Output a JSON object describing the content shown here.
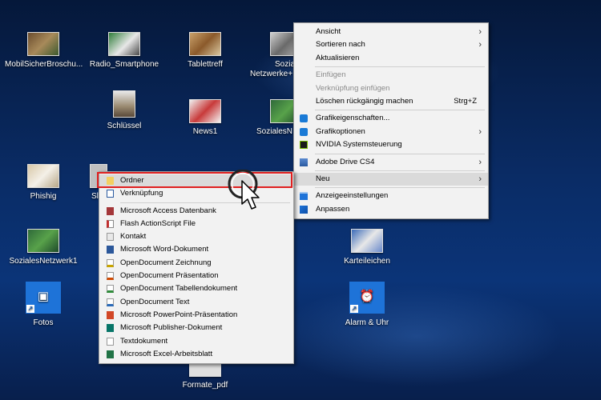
{
  "desktop": {
    "icons": [
      {
        "label": "MobilSicherBroschu..."
      },
      {
        "label": "Radio_Smartphone"
      },
      {
        "label": "Tablettreff"
      },
      {
        "label": "Sozia"
      },
      {
        "label2": "Netzwerke+"
      },
      {
        "label": "Schlüssel"
      },
      {
        "label": "News1"
      },
      {
        "label": "SozialesN"
      },
      {
        "label": "Phishig"
      },
      {
        "label": "Sl"
      },
      {
        "label": "SozialesNetzwerk1"
      },
      {
        "label": "Karteileichen"
      },
      {
        "label": "Fotos"
      },
      {
        "label": "Alarm & Uhr"
      },
      {
        "label": "Formate_pdf"
      }
    ]
  },
  "context_menu": {
    "items": [
      {
        "label": "Ansicht",
        "submenu": true
      },
      {
        "label": "Sortieren nach",
        "submenu": true
      },
      {
        "label": "Aktualisieren"
      },
      {
        "label": "Einfügen",
        "disabled": true
      },
      {
        "label": "Verknüpfung einfügen",
        "disabled": true
      },
      {
        "label": "Löschen rückgängig machen",
        "shortcut": "Strg+Z"
      },
      {
        "label": "Grafikeigenschaften...",
        "icon": "intel-graphics-icon"
      },
      {
        "label": "Grafikoptionen",
        "icon": "intel-graphics-icon",
        "submenu": true
      },
      {
        "label": "NVIDIA Systemsteuerung",
        "icon": "nvidia-icon"
      },
      {
        "label": "Adobe Drive CS4",
        "icon": "adobe-drive-icon",
        "submenu": true
      },
      {
        "label": "Neu",
        "submenu": true
      },
      {
        "label": "Anzeigeeinstellungen",
        "icon": "display-settings-icon"
      },
      {
        "label": "Anpassen",
        "icon": "personalize-icon"
      }
    ]
  },
  "new_submenu": {
    "items": [
      {
        "label": "Ordner",
        "icon": "folder-icon"
      },
      {
        "label": "Verknüpfung",
        "icon": "shortcut-icon"
      },
      {
        "label": "Microsoft Access Datenbank",
        "icon": "access-icon"
      },
      {
        "label": "Flash ActionScript File",
        "icon": "flash-file-icon"
      },
      {
        "label": "Kontakt",
        "icon": "contact-icon"
      },
      {
        "label": "Microsoft Word-Dokument",
        "icon": "word-icon"
      },
      {
        "label": "OpenDocument Zeichnung",
        "icon": "odg-icon"
      },
      {
        "label": "OpenDocument Präsentation",
        "icon": "odp-icon"
      },
      {
        "label": "OpenDocument Tabellendokument",
        "icon": "ods-icon"
      },
      {
        "label": "OpenDocument Text",
        "icon": "odt-icon"
      },
      {
        "label": "Microsoft PowerPoint-Präsentation",
        "icon": "powerpoint-icon"
      },
      {
        "label": "Microsoft Publisher-Dokument",
        "icon": "publisher-icon"
      },
      {
        "label": "Textdokument",
        "icon": "text-document-icon"
      },
      {
        "label": "Microsoft Excel-Arbeitsblatt",
        "icon": "excel-icon"
      }
    ]
  },
  "colors": {
    "highlight_box": "#e02020",
    "menu_bg": "#f2f2f2",
    "tile_blue": "#1e73d8"
  }
}
